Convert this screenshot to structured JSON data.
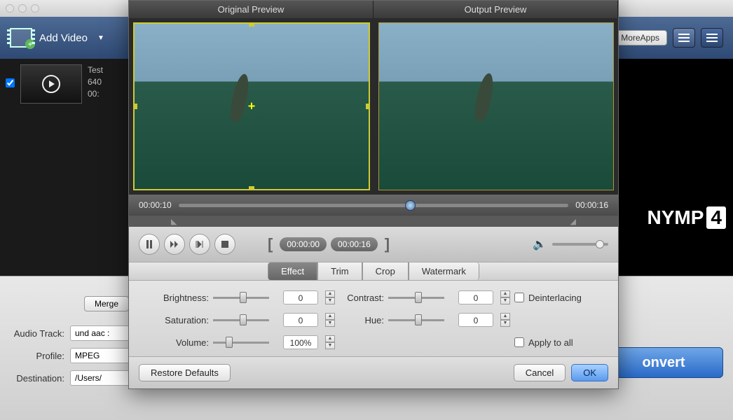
{
  "titlebar": {
    "title": ""
  },
  "toolbar": {
    "addvideo_label": "Add Video",
    "moreapps_label": "MoreApps"
  },
  "list": {
    "items": [
      {
        "title": "Test",
        "resolution": "640",
        "duration": "00:"
      }
    ]
  },
  "preview": {
    "brand_part": "NYMP",
    "brand_num": "4",
    "duration": "00:00:16"
  },
  "lower": {
    "merge_label": "Merge",
    "audio_track_label": "Audio Track:",
    "audio_track_value": "und aac :",
    "profile_label": "Profile:",
    "profile_value": "MPEG",
    "destination_label": "Destination:",
    "destination_value": "/Users/",
    "convert_label": "onvert"
  },
  "modal": {
    "headers": {
      "left": "Original Preview",
      "right": "Output Preview"
    },
    "timeline": {
      "start": "00:00:10",
      "end": "00:00:16"
    },
    "clip": {
      "in": "00:00:00",
      "out": "00:00:16"
    },
    "tabs": [
      "Effect",
      "Trim",
      "Crop",
      "Watermark"
    ],
    "active_tab": 0,
    "effect": {
      "brightness_label": "Brightness:",
      "brightness_value": "0",
      "contrast_label": "Contrast:",
      "contrast_value": "0",
      "saturation_label": "Saturation:",
      "saturation_value": "0",
      "hue_label": "Hue:",
      "hue_value": "0",
      "volume_label": "Volume:",
      "volume_value": "100%",
      "deinterlacing_label": "Deinterlacing",
      "apply_label": "Apply to all"
    },
    "footer": {
      "restore_label": "Restore Defaults",
      "cancel_label": "Cancel",
      "ok_label": "OK"
    }
  }
}
